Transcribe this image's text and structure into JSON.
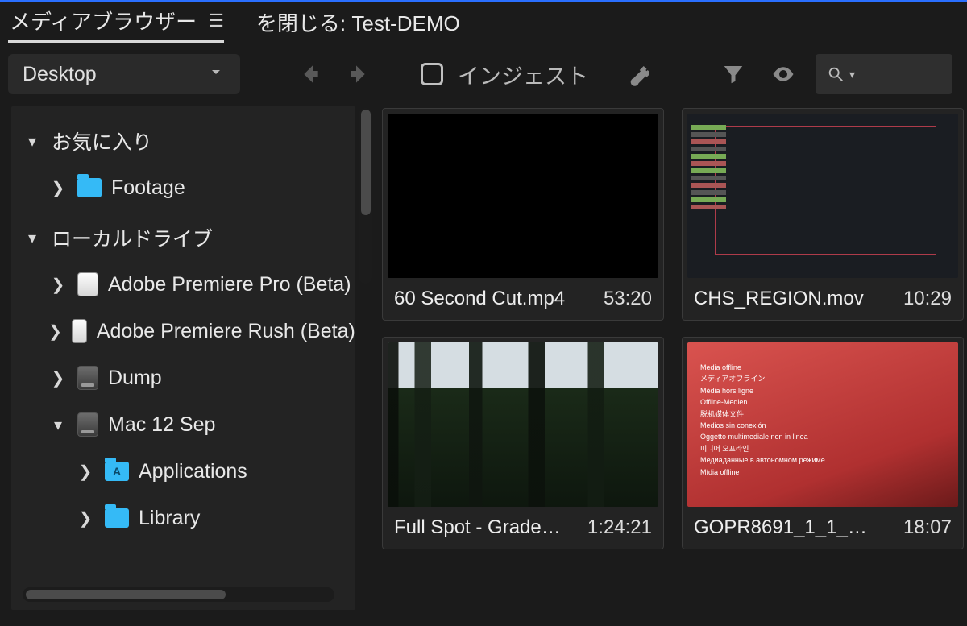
{
  "panel_tab": "メディアブラウザー",
  "close_label": "を閉じる: Test-DEMO",
  "toolbar": {
    "dropdown_value": "Desktop",
    "ingest_label": "インジェスト"
  },
  "sidebar": {
    "sections": [
      {
        "label": "お気に入り",
        "expanded": true
      },
      {
        "label": "ローカルドライブ",
        "expanded": true
      }
    ],
    "favorites": [
      {
        "label": "Footage",
        "type": "folder",
        "expanded": false
      }
    ],
    "drives": [
      {
        "label": "Adobe Premiere Pro (Beta)",
        "type": "drive-light",
        "expanded": false
      },
      {
        "label": "Adobe Premiere Rush (Beta)",
        "type": "drive-light",
        "expanded": false
      },
      {
        "label": "Dump",
        "type": "drive-dark",
        "expanded": false
      },
      {
        "label": "Mac 12 Sep",
        "type": "drive-dark",
        "expanded": true,
        "children": [
          {
            "label": "Applications",
            "type": "folder-app"
          },
          {
            "label": "Library",
            "type": "folder"
          }
        ]
      }
    ]
  },
  "media": [
    {
      "name": "60 Second Cut.mp4",
      "duration": "53:20",
      "thumb": "black"
    },
    {
      "name": "CHS_REGION.mov",
      "duration": "10:29",
      "thumb": "editor"
    },
    {
      "name": "Full Spot - Grade…",
      "duration": "1:24:21",
      "thumb": "forest"
    },
    {
      "name": "GOPR8691_1_1_1…",
      "duration": "18:07",
      "thumb": "offline"
    }
  ],
  "offline_text": [
    "Media offline",
    "メディアオフライン",
    "Média hors ligne",
    "Offline-Medien",
    "脱机媒体文件",
    "Medios sin conexión",
    "Oggetto multimediale non in linea",
    "미디어 오프라인",
    "Медиаданные в автономном режиме",
    "Mídia offline"
  ]
}
